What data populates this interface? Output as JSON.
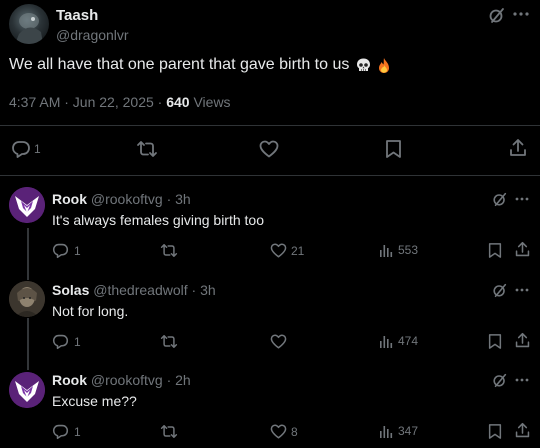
{
  "main_tweet": {
    "display_name": "Taash",
    "handle": "@dragonlvr",
    "text": "We all have that one parent that gave birth to us",
    "emojis": [
      "skull",
      "fire"
    ],
    "timestamp": "4:37 AM · Jun 22, 2025 · ",
    "views_count": "640",
    "views_label": " Views",
    "reply_count": "1",
    "icons": [
      "grok-icon",
      "more-icon",
      "reply-icon",
      "retweet-icon",
      "like-icon",
      "bookmark-icon",
      "share-icon"
    ]
  },
  "replies": [
    {
      "display_name": "Rook",
      "handle": "@rookoftvg · 3h",
      "text": "It's always females giving birth too",
      "reply_count": "1",
      "like_count": "21",
      "view_count": "553"
    },
    {
      "display_name": "Solas",
      "handle": "@thedreadwolf · 3h",
      "text": "Not for long.",
      "reply_count": "1",
      "like_count": "",
      "view_count": "474"
    },
    {
      "display_name": "Rook",
      "handle": "@rookoftvg · 2h",
      "text": "Excuse me??",
      "reply_count": "1",
      "like_count": "8",
      "view_count": "347"
    }
  ],
  "colors": {
    "background": "#000000",
    "text": "#e7e9ea",
    "muted": "#71767b",
    "divider": "#2f3336",
    "rook_avatar": "#6b2a8f"
  }
}
